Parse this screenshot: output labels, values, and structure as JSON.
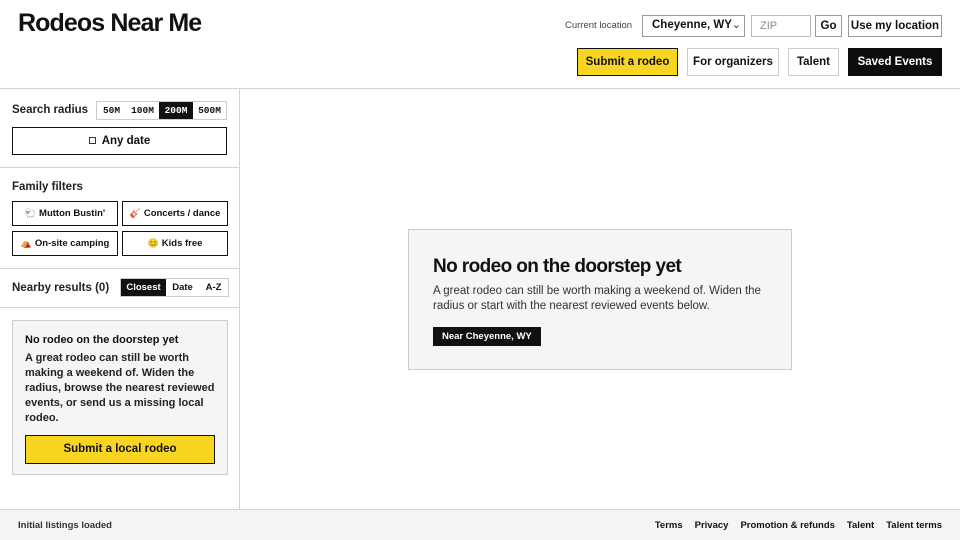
{
  "header": {
    "brand": "Rodeos Near Me",
    "current_location_label": "Current location",
    "location_value": "Cheyenne, WY",
    "zip_placeholder": "ZIP",
    "go_label": "Go",
    "use_location_label": "Use my location",
    "nav": {
      "submit": "Submit a rodeo",
      "organizers": "For organizers",
      "talent": "Talent",
      "saved": "Saved Events"
    }
  },
  "sidebar": {
    "radius_label": "Search radius",
    "radius_options": [
      "50M",
      "100M",
      "200M",
      "500M"
    ],
    "radius_selected": "200M",
    "any_date_label": "Any date",
    "family_filters_label": "Family filters",
    "filters": [
      {
        "icon": "🐑",
        "label": "Mutton Bustin'"
      },
      {
        "icon": "🎸",
        "label": "Concerts / dance"
      },
      {
        "icon": "⛺",
        "label": "On-site camping"
      },
      {
        "icon": "😊",
        "label": "Kids free"
      }
    ],
    "results_label": "Nearby results (0)",
    "sort_options": [
      "Closest",
      "Date",
      "A-Z"
    ],
    "sort_selected": "Closest",
    "card": {
      "title": "No rodeo on the doorstep yet",
      "body": "A great rodeo can still be worth making a weekend of. Widen the radius, browse the nearest reviewed events, or send us a missing local rodeo.",
      "button": "Submit a local rodeo"
    }
  },
  "main": {
    "empty_title": "No rodeo on the doorstep yet",
    "empty_body": "A great rodeo can still be worth making a weekend of. Widen the radius or start with the nearest reviewed events below.",
    "near_badge": "Near Cheyenne, WY"
  },
  "footer": {
    "status": "Initial listings loaded",
    "links": [
      "Terms",
      "Privacy",
      "Promotion & refunds",
      "Talent",
      "Talent terms"
    ]
  },
  "colors": {
    "accent_yellow": "#f8d520",
    "dark": "#0d0d0d",
    "panel_gray": "#f5f5f5",
    "border": "#d4d4d4"
  }
}
